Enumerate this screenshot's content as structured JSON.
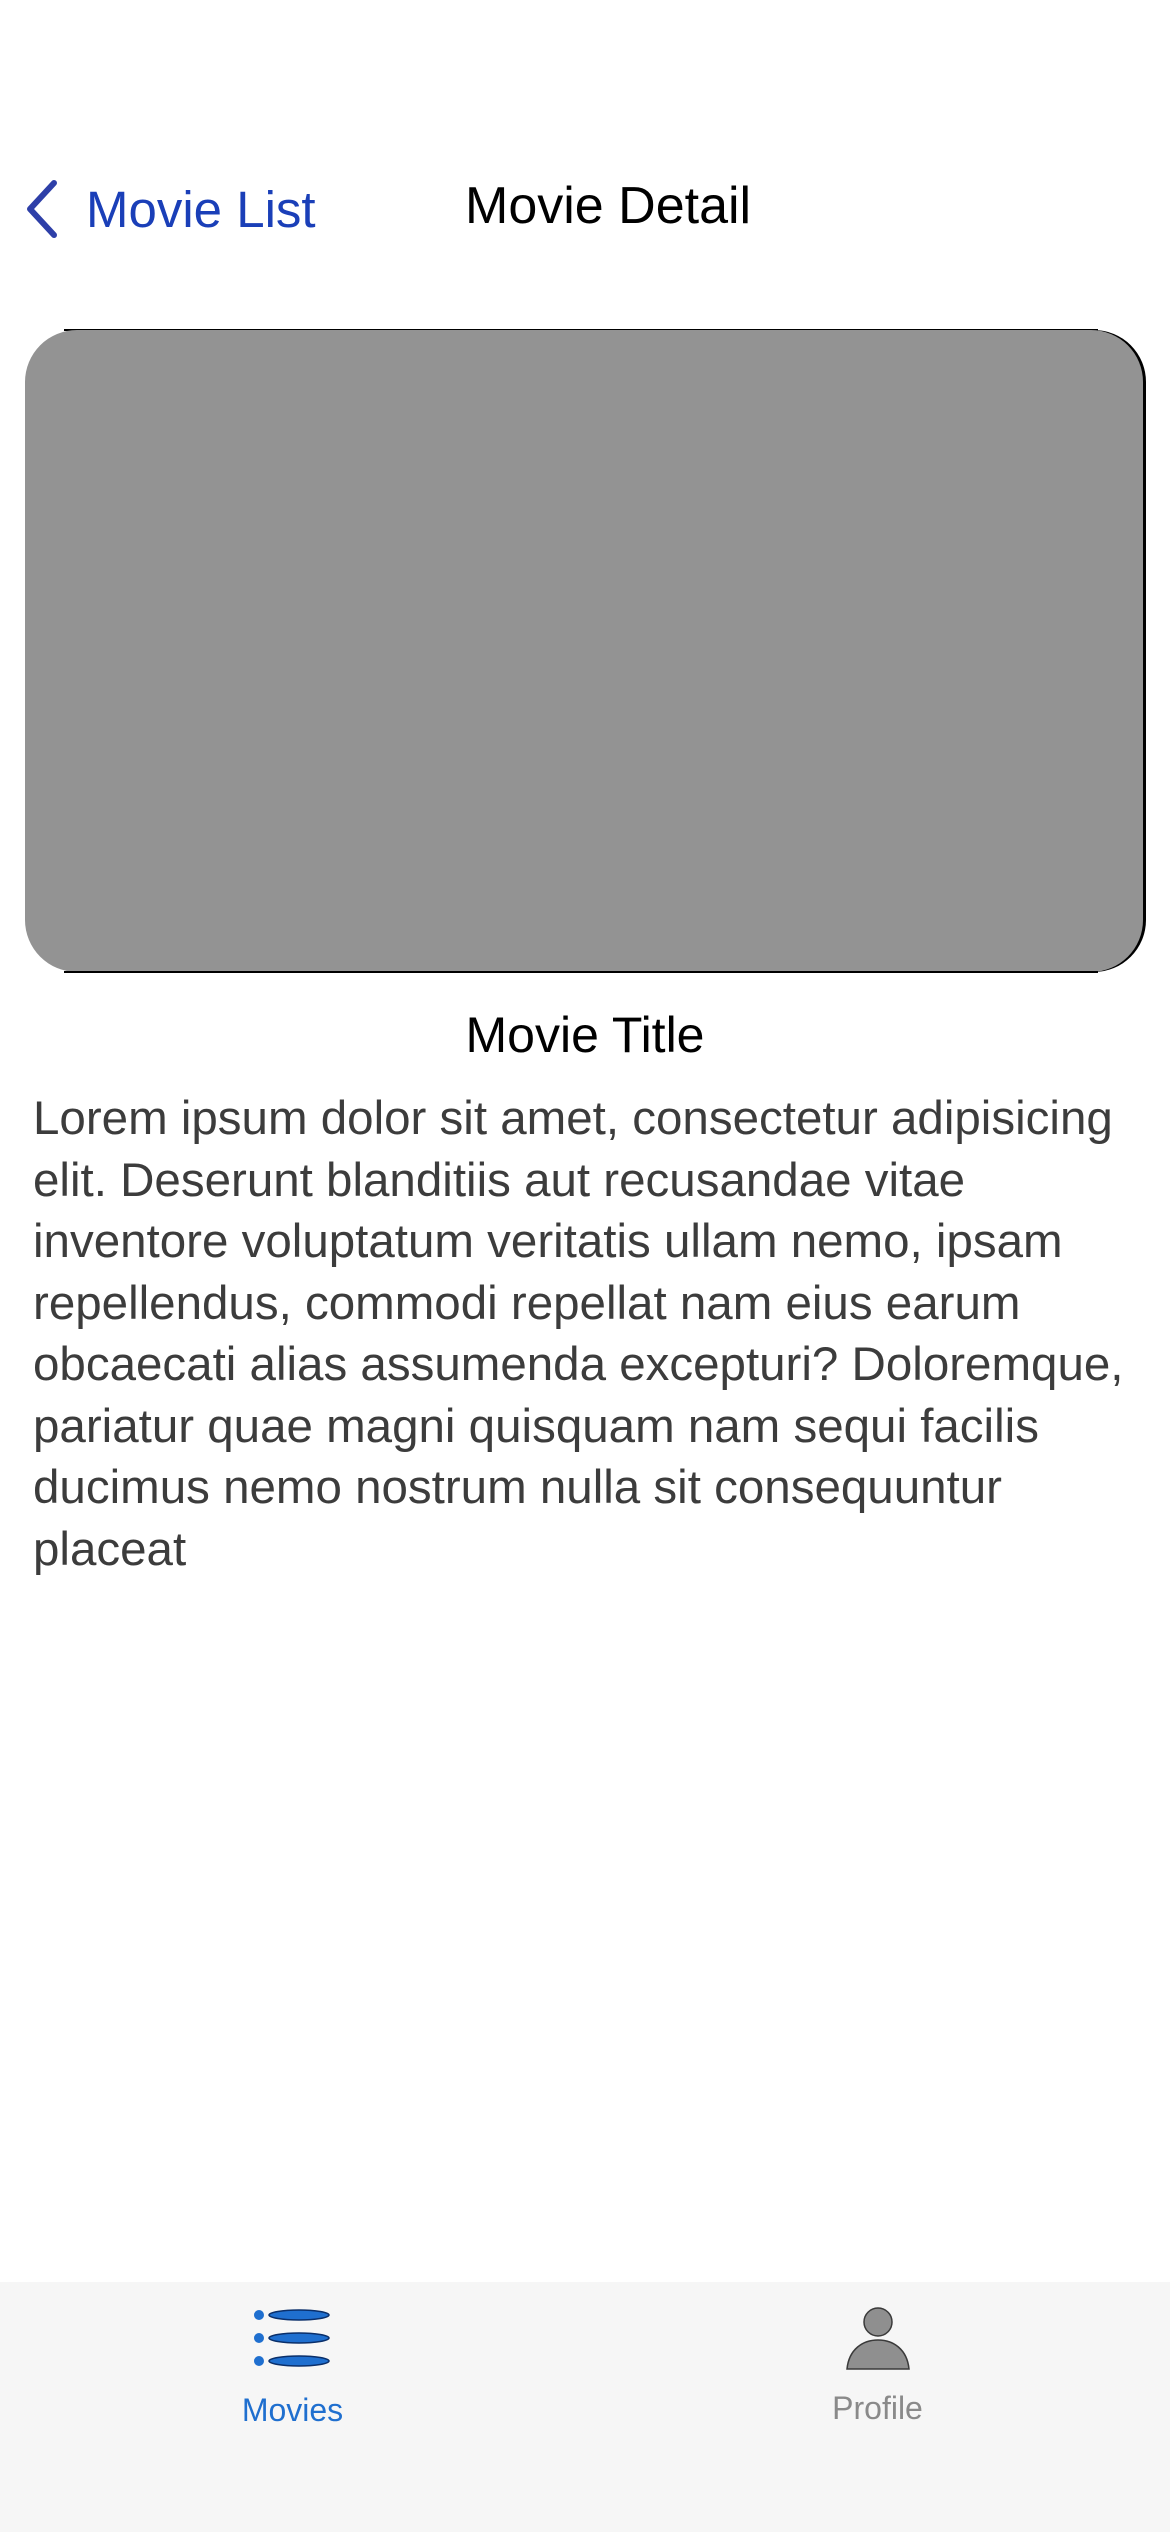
{
  "nav": {
    "back_label": "Movie List",
    "title": "Movie Detail",
    "back_icon": "chevron-left-icon"
  },
  "movie": {
    "title": "Movie Title",
    "description": "Lorem ipsum dolor sit amet, consectetur adipisicing elit. Deserunt blanditiis aut recusandae vitae inventore voluptatum veritatis ullam nemo, ipsam repellendus, commodi repellat nam eius earum obcaecati alias assumenda excepturi? Doloremque, pariatur quae magni quisquam nam sequi facilis ducimus nemo nostrum nulla sit consequuntur placeat",
    "poster_placeholder_color": "#939393"
  },
  "tabs": [
    {
      "label": "Movies",
      "icon": "list-icon",
      "selected": true
    },
    {
      "label": "Profile",
      "icon": "person-icon",
      "selected": false
    }
  ],
  "colors": {
    "accent": "#1a3fb8",
    "tab_active": "#1f6fcf",
    "tab_inactive": "#8a8a8a",
    "tab_bar_bg": "#f6f6f6"
  }
}
